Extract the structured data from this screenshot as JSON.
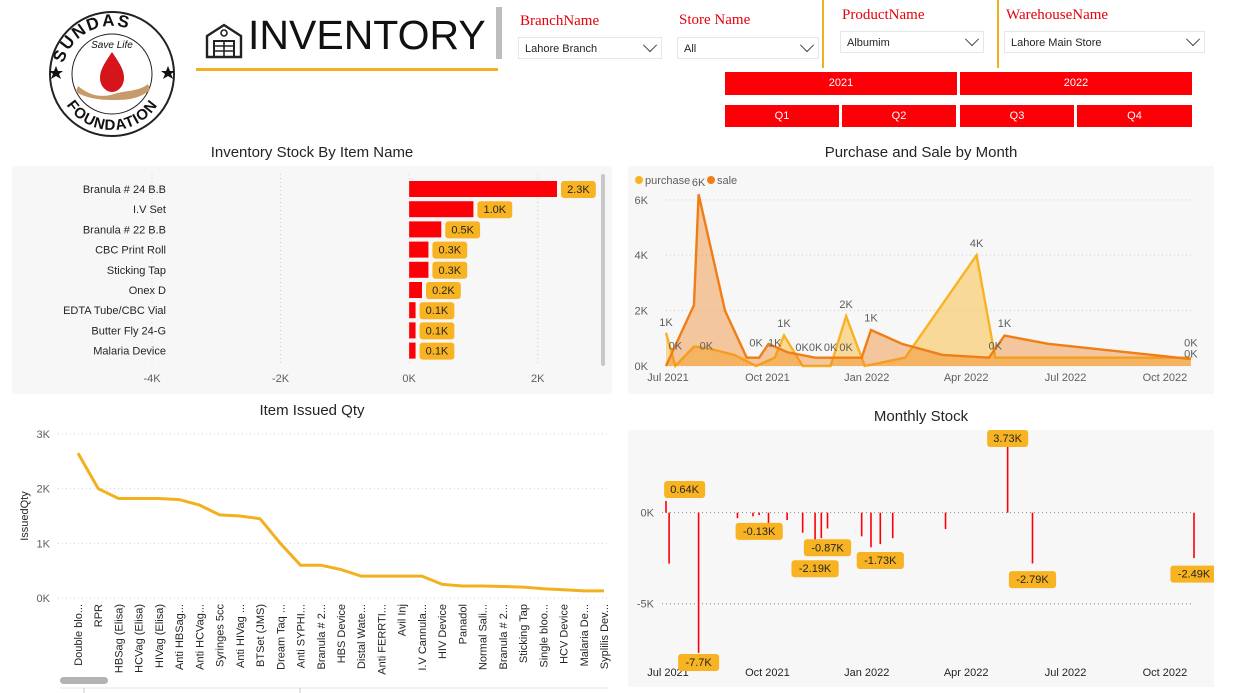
{
  "header": {
    "title": "INVENTORY",
    "logo": {
      "top_text": "SUNDAS",
      "middle_text": "Save Life",
      "bottom_text": "FOUNDATION"
    }
  },
  "slicers": {
    "branch": {
      "label": "BranchName",
      "value": "Lahore Branch"
    },
    "store": {
      "label": "Store Name",
      "value": "All"
    },
    "product": {
      "label": "ProductName",
      "value": "Albumim"
    },
    "warehouse": {
      "label": "WarehouseName",
      "value": "Lahore Main Store"
    },
    "years": [
      "2021",
      "2022"
    ],
    "quarters": [
      "Q1",
      "Q2",
      "Q3",
      "Q4"
    ]
  },
  "colors": {
    "accent_red": "#fb0007",
    "accent_yellow": "#f2b01e",
    "sale_orange": "#f07d16",
    "purchase_yellow": "#f8b323"
  },
  "chart_data": [
    {
      "id": "inventory-stock",
      "type": "bar",
      "title": "Inventory Stock By Item Name",
      "categories": [
        "Branula # 24 B.B",
        "I.V Set",
        "Branula # 22 B.B",
        "CBC Print Roll",
        "Sticking Tap",
        "Onex D",
        "EDTA Tube/CBC Vial",
        "Butter Fly 24-G",
        "Malaria Device"
      ],
      "values": [
        2300,
        1000,
        500,
        300,
        300,
        200,
        100,
        100,
        100
      ],
      "labels": [
        "2.3K",
        "1.0K",
        "0.5K",
        "0.3K",
        "0.3K",
        "0.2K",
        "0.1K",
        "0.1K",
        "0.1K"
      ],
      "xticks": [
        "-4K",
        "-2K",
        "0K",
        "2K"
      ],
      "xlim": [
        -4000,
        3000
      ]
    },
    {
      "id": "purchase-sale",
      "type": "area",
      "title": "Purchase and Sale by Month",
      "legend": [
        "purchase",
        "sale"
      ],
      "legend_position": "top-left",
      "x": [
        "2021-07",
        "2021-07b",
        "2021-08",
        "2021-08b",
        "2021-09",
        "2021-09b",
        "2021-10",
        "2021-10b",
        "2021-11",
        "2021-11b",
        "2021-12",
        "2021-12b",
        "2022-01",
        "2022-01b",
        "2022-02",
        "2022-03",
        "2022-04",
        "2022-05",
        "2022-06",
        "2022-07",
        "2022-08",
        "2022-09",
        "2022-10",
        "2022-11",
        "2022-12"
      ],
      "series": [
        {
          "name": "purchase",
          "color": "#f8b323",
          "points": [
            [
              0.0,
              1200
            ],
            [
              0.3,
              0
            ],
            [
              0.9,
              700
            ],
            [
              1.3,
              650
            ],
            [
              2.2,
              400
            ],
            [
              2.9,
              0
            ],
            [
              3.5,
              300
            ],
            [
              3.8,
              1100
            ],
            [
              4.4,
              0
            ],
            [
              5.3,
              0
            ],
            [
              5.8,
              1800
            ],
            [
              6.4,
              0
            ],
            [
              7.7,
              300
            ],
            [
              10.0,
              4000
            ],
            [
              10.6,
              300
            ],
            [
              11.2,
              300
            ],
            [
              12.3,
              300
            ],
            [
              16.9,
              300
            ]
          ]
        },
        {
          "name": "sale",
          "color": "#f07d16",
          "points": [
            [
              0.0,
              0
            ],
            [
              0.9,
              2200
            ],
            [
              1.05,
              6200
            ],
            [
              1.9,
              2000
            ],
            [
              2.6,
              300
            ],
            [
              3.0,
              300
            ],
            [
              3.3,
              800
            ],
            [
              3.9,
              500
            ],
            [
              4.8,
              300
            ],
            [
              5.3,
              300
            ],
            [
              6.3,
              300
            ],
            [
              6.6,
              1300
            ],
            [
              7.6,
              800
            ],
            [
              8.9,
              400
            ],
            [
              10.4,
              300
            ],
            [
              10.9,
              1100
            ],
            [
              12.3,
              800
            ],
            [
              16.9,
              250
            ]
          ]
        }
      ],
      "point_labels": [
        "1K",
        "6K",
        "0K",
        "0K",
        "0K",
        "1K",
        "1K",
        "0K0K",
        "0K",
        "2K",
        "1K",
        "0K",
        "4K",
        "0K",
        "1K",
        "0K",
        "0K"
      ],
      "yticks": [
        "0K",
        "2K",
        "4K",
        "6K"
      ],
      "xticks": [
        "Jul 2021",
        "Oct 2021",
        "Jan 2022",
        "Apr 2022",
        "Jul 2022",
        "Oct 2022"
      ],
      "ylim": [
        0,
        6500
      ]
    },
    {
      "id": "item-issued",
      "type": "line",
      "title": "Item Issued Qty",
      "ylabel": "IssuedQty",
      "categories": [
        "Double blo...",
        "RPR",
        "HBSag (Elisa)",
        "HCVag (Elisa)",
        "HIVag (Elisa)",
        "Anti HBSag...",
        "Anti HCVag...",
        "Syringes 5cc",
        "Anti HIVag ...",
        "BTSet (JMS)",
        "Dream Taq ...",
        "Anti SYPHI...",
        "Branula # 2...",
        "HBS Device",
        "Distal Wate...",
        "Anti FERRTI...",
        "Avil Inj",
        "I.V Cannula...",
        "HIV Device",
        "Panadol",
        "Normal Sali...",
        "Branula # 2...",
        "Sticking Tap",
        "Single bloo...",
        "HCV Device",
        "Malaria De...",
        "Syplilis Dev..."
      ],
      "values": [
        2650,
        2000,
        1820,
        1820,
        1820,
        1800,
        1700,
        1520,
        1500,
        1450,
        1000,
        600,
        600,
        520,
        400,
        400,
        400,
        400,
        250,
        220,
        220,
        210,
        200,
        170,
        150,
        130,
        130
      ],
      "yticks": [
        "0K",
        "1K",
        "2K",
        "3K"
      ],
      "ylim": [
        0,
        3000
      ]
    },
    {
      "id": "monthly-stock",
      "type": "bar",
      "title": "Monthly Stock",
      "xticks": [
        "Jul 2021",
        "Oct 2021",
        "Jan 2022",
        "Apr 2022",
        "Jul 2022",
        "Oct 2022"
      ],
      "yticks": [
        "0K",
        "-5K"
      ],
      "bars": [
        [
          0.0,
          640
        ],
        [
          0.1,
          -2800
        ],
        [
          1.05,
          -7700
        ],
        [
          2.3,
          -300
        ],
        [
          2.8,
          -200
        ],
        [
          3.0,
          -130
        ],
        [
          3.3,
          -900
        ],
        [
          3.9,
          -400
        ],
        [
          4.4,
          -1100
        ],
        [
          4.8,
          -2190
        ],
        [
          5.0,
          -1400
        ],
        [
          5.2,
          -870
        ],
        [
          6.3,
          -1300
        ],
        [
          6.6,
          -1900
        ],
        [
          6.9,
          -1730
        ],
        [
          7.3,
          -1400
        ],
        [
          9.0,
          -900
        ],
        [
          11.0,
          3730
        ],
        [
          11.8,
          -2790
        ],
        [
          17.0,
          -2490
        ]
      ],
      "labels": [
        "0.64K",
        "-7.7K",
        "-0.13K",
        "-0.87K",
        "-2.19K",
        "-1.73K",
        "3.73K",
        "-2.79K",
        "-2.49K"
      ],
      "ylim": [
        -8200,
        4100
      ]
    }
  ]
}
